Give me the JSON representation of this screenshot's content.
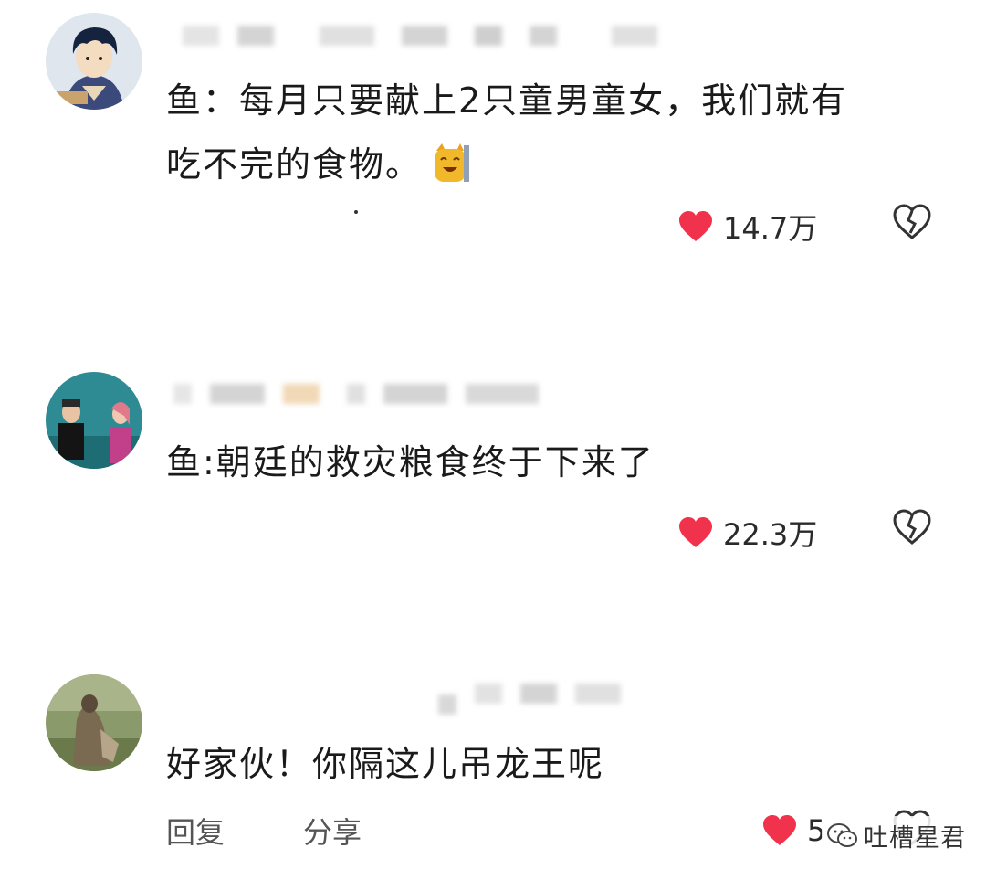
{
  "comments": [
    {
      "text_line1": "鱼：每月只要献上2只童男童女，我们就有",
      "text_line2": "吃不完的食物。",
      "emoji": "laughing-cat-emoji",
      "likes": "14.7万"
    },
    {
      "text_line1": "鱼:朝廷的救灾粮食终于下来了",
      "likes": "22.3万"
    },
    {
      "text_line1": "好家伙！你隔这儿吊龙王呢",
      "likes": "5"
    }
  ],
  "actions": {
    "reply": "回复",
    "share": "分享"
  },
  "watermark": {
    "text": "吐槽星君",
    "icon": "wechat-icon"
  },
  "colors": {
    "heart": "#f0324d",
    "text": "#1a1a1a",
    "muted": "#555555"
  }
}
